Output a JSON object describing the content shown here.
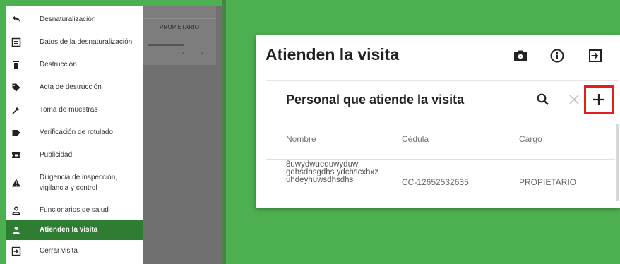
{
  "sidebar": {
    "items": [
      {
        "label": "Desnaturalización",
        "icon": "undo-icon"
      },
      {
        "label": "Datos de la desnaturalización",
        "icon": "document-list-icon"
      },
      {
        "label": "Destrucción",
        "icon": "trash-icon"
      },
      {
        "label": "Acta de destrucción",
        "icon": "tag-icon"
      },
      {
        "label": "Toma de muestras",
        "icon": "dropper-icon"
      },
      {
        "label": "Verificación de rotulado",
        "icon": "label-icon"
      },
      {
        "label": "Publicidad",
        "icon": "ticket-icon"
      },
      {
        "label": "Diligencia de inspección, vigilancia y control",
        "icon": "warning-icon"
      },
      {
        "label": "Funcionarios de salud",
        "icon": "person-outline-icon"
      },
      {
        "label": "Atienden la visita",
        "icon": "person-icon",
        "active": true
      },
      {
        "label": "Cerrar visita",
        "icon": "exit-icon"
      }
    ]
  },
  "background": {
    "role": "PROPIETARIO",
    "pager_prev": "‹",
    "pager_next": "›"
  },
  "dialog": {
    "title": "Atienden la visita",
    "icons": [
      "camera-icon",
      "info-icon",
      "exit-icon"
    ],
    "panel": {
      "title": "Personal que atiende la visita",
      "columns": [
        "Nombre",
        "Cédula",
        "Cargo"
      ],
      "rows": [
        {
          "nombre": "8uwydwueduwyduw gdhsdhsgdhs ydchscxhxz uhdeyhuwsdhsdhs",
          "cedula": "CC-12652532635",
          "cargo": "PROPIETARIO"
        }
      ]
    }
  },
  "colors": {
    "background": "#4caf50",
    "active_nav": "#2e7d32",
    "highlight": "#e02020"
  }
}
